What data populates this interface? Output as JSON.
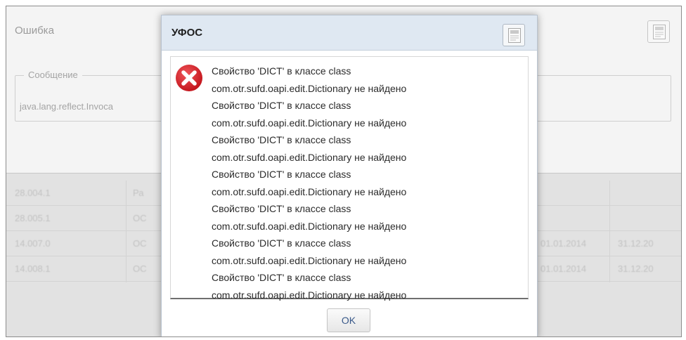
{
  "background": {
    "error_panel": {
      "title": "Ошибка",
      "message_group_label": "Сообщение",
      "message_text": "java.lang.reflect.Invoca",
      "export_icon": "document-export-icon"
    },
    "table_rows": [
      {
        "code": "28.004.1",
        "name": "Ра"
      },
      {
        "code": "28.005.1",
        "name": "ОС"
      },
      {
        "code": "14.007.0",
        "name": "ОС",
        "date_from": "01.01.2014",
        "date_to": "31.12.20"
      },
      {
        "code": "14.008.1",
        "name": "ОС",
        "date_from": "01.01.2014",
        "date_to": "31.12.20"
      }
    ]
  },
  "dialog": {
    "title": "УФОС",
    "export_icon": "document-export-icon",
    "status_icon": "error-icon",
    "status_color": "#d9272e",
    "messages": [
      "Свойство 'DICT' в классе class",
      "com.otr.sufd.oapi.edit.Dictionary не найдено",
      "Свойство 'DICT' в классе class",
      "com.otr.sufd.oapi.edit.Dictionary не найдено",
      "Свойство 'DICT' в классе class",
      "com.otr.sufd.oapi.edit.Dictionary не найдено",
      "Свойство 'DICT' в классе class",
      "com.otr.sufd.oapi.edit.Dictionary не найдено",
      "Свойство 'DICT' в классе class",
      "com.otr.sufd.oapi.edit.Dictionary не найдено",
      "Свойство 'DICT' в классе class",
      "com.otr.sufd.oapi.edit.Dictionary не найдено",
      "Свойство 'DICT' в классе class",
      "com.otr.sufd.oapi.edit.Dictionary не найдено"
    ],
    "ok_label": "OK"
  }
}
